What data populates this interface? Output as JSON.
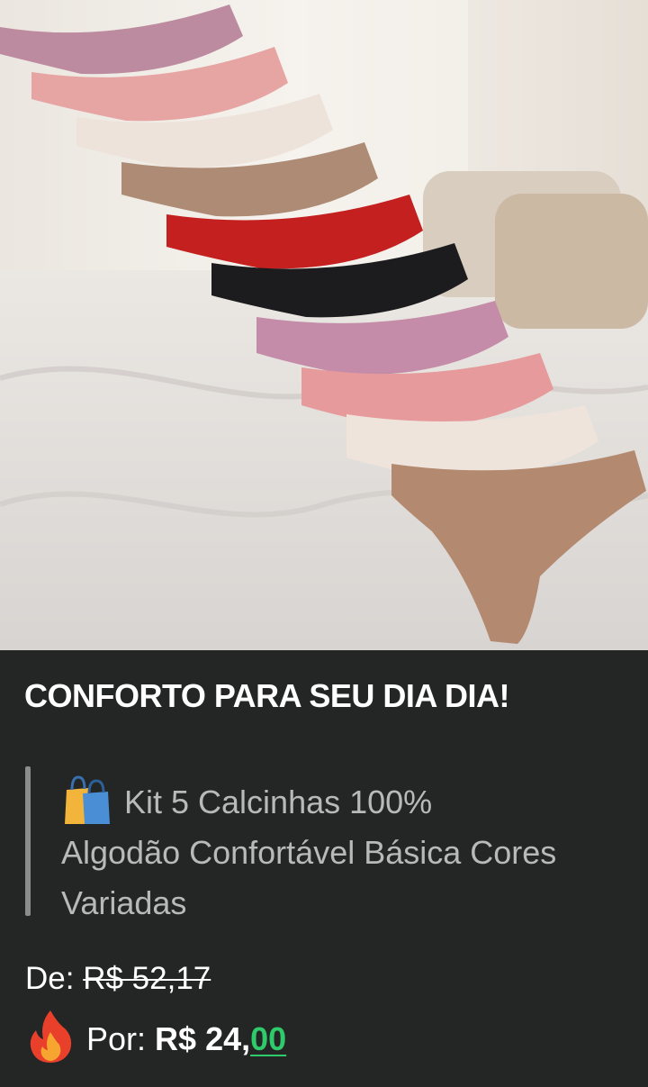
{
  "hero": {
    "image_alt": "Kit de calcinhas coloridas sobre cama branca"
  },
  "post": {
    "headline": "CONFORTO PARA SEU DIA DIA!",
    "product_icon": "shopping-bags-icon",
    "product_line1": "Kit 5 Calcinhas 100%",
    "product_rest": "Algodão Confortável Básica Cores Variadas",
    "old_price_label": "De:",
    "old_price_value": "R$ 52,17",
    "new_price_icon": "fire-icon",
    "new_price_label": "Por:",
    "new_price_whole": "R$ 24,",
    "new_price_cents": "00"
  },
  "colors": {
    "background": "#232625",
    "headline": "#ffffff",
    "quote_text": "#b7bab9",
    "price_cents": "#2fca6a"
  }
}
